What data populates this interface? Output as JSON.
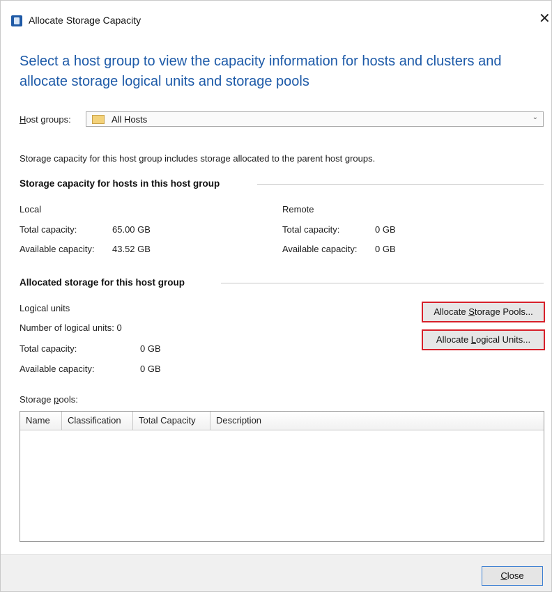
{
  "window": {
    "title": "Allocate Storage Capacity",
    "close_glyph": "✕",
    "icon": "app-icon"
  },
  "heading": "Select a host group to view the capacity information for hosts and clusters and allocate storage logical units and storage pools",
  "host_groups": {
    "label_underlined": "H",
    "label_rest": "ost groups:",
    "selected": "All Hosts",
    "folder_icon": "folder-icon",
    "arrow": "⌄"
  },
  "note": "Storage capacity for this host group includes storage allocated to the parent host groups.",
  "hosts_section": {
    "title": "Storage capacity for hosts in this host group",
    "local": {
      "label": "Local",
      "total_label": "Total capacity:",
      "total_value": "65.00 GB",
      "available_label": "Available capacity:",
      "available_value": "43.52 GB"
    },
    "remote": {
      "label": "Remote",
      "total_label": "Total capacity:",
      "total_value": "0 GB",
      "available_label": "Available capacity:",
      "available_value": "0 GB"
    }
  },
  "allocated_section": {
    "title": "Allocated storage for this host group",
    "logical_units_label": "Logical units",
    "number_label": "Number of logical units:",
    "number_value": "0",
    "total_label": "Total capacity:",
    "total_value": "0 GB",
    "available_label": "Available capacity:",
    "available_value": "0 GB",
    "btn_pools_pre": "Allocate ",
    "btn_pools_u": "S",
    "btn_pools_post": "torage Pools...",
    "btn_units_pre": "Allocate ",
    "btn_units_u": "L",
    "btn_units_post": "ogical Units..."
  },
  "storage_pools": {
    "label_pre": "Storage ",
    "label_u": "p",
    "label_post": "ools:",
    "columns": [
      "Name",
      "Classification",
      "Total Capacity",
      "Description"
    ]
  },
  "footer": {
    "close_u": "C",
    "close_rest": "lose"
  },
  "colors": {
    "heading": "#1d5aa8",
    "highlight_border": "#d7202a",
    "default_button_border": "#3c7fd2"
  }
}
